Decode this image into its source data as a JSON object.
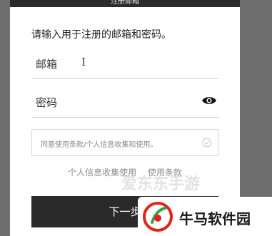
{
  "dialog": {
    "title": "注册邮箱",
    "instruction": "请输入用于注册的邮箱和密码。",
    "email_placeholder": "邮箱",
    "password_placeholder": "密码",
    "consent_text": "同意使用条款/个人信息收集和使用。",
    "links": {
      "privacy": "个人信息收集使用",
      "terms": "使用条款"
    },
    "next_label": "下一步"
  },
  "watermarks": {
    "site_1": "爱东东手游",
    "site_2": "牛马软件园"
  },
  "icons": {
    "cursor": "text-cursor-icon",
    "password_toggle": "eye-icon",
    "consent_check": "check-circle-icon"
  },
  "colors": {
    "button_bg": "#2a2a2a",
    "logo_red": "#e2231a",
    "logo_green": "#2aa84a"
  }
}
